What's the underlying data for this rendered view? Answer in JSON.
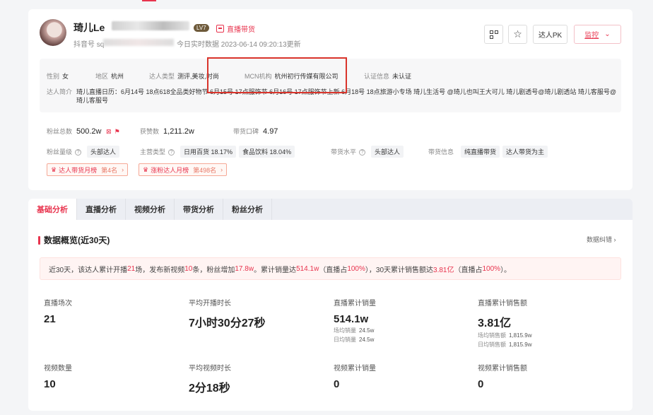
{
  "profile": {
    "name": "琦儿Le",
    "level_badge": "LV7",
    "live_tag": "直播带货",
    "douyin_id": "抖音号 sq",
    "update_text": "今日实时数据   2023-06-14 09:20:13更新",
    "pk_label": "达人PK",
    "monitor_label": "监控",
    "gender_label": "性别",
    "gender": "女",
    "region_label": "地区",
    "region": "杭州",
    "type_label": "达人类型",
    "type": "测评,美妆,时尚",
    "mcn_label": "MCN机构",
    "mcn": "杭州初行传媒有限公司",
    "verify_label": "认证信息",
    "verify": "未认证",
    "intro_label": "达人简介",
    "intro": "琦儿直播日历：6月14号 18点618全品类好物节 6月15号 17点服饰节 6月16号 17点服饰节上新 6月18号 18点旅游小专场 琦儿生活号 @琦儿也叫王大可儿 琦儿剧透号@琦儿剧透站 琦儿客服号@琦儿客服号"
  },
  "stats": {
    "fans_label": "粉丝总数",
    "fans": "500.2w",
    "likes_label": "获赞数",
    "likes": "1,211.2w",
    "reputation_label": "带货口碑",
    "reputation": "4.97",
    "fans_level_label": "粉丝量级",
    "fans_level": "头部达人",
    "category_label": "主营类型",
    "category_1": "日用百货 18.17%",
    "category_2": "食品饮料 18.04%",
    "sales_level_label": "带货水平",
    "sales_level": "头部达人",
    "sales_info_label": "带货信息",
    "sales_info_1": "纯直播带货",
    "sales_info_2": "达人带货为主",
    "rank_1": "达人带货月榜",
    "rank_1_pos": "第4名",
    "rank_2": "涨粉达人月榜",
    "rank_2_pos": "第498名"
  },
  "tabs": [
    "基础分析",
    "直播分析",
    "视频分析",
    "带货分析",
    "粉丝分析"
  ],
  "overview": {
    "title": "数据概览(近30天)",
    "export": "数据纠错",
    "summary": {
      "p1": "近30天，该达人累计开播",
      "live_count": "21",
      "p2": "场，发布新视频",
      "video_count": "10",
      "p3": "条，粉丝增加",
      "fans_growth": "17.8w",
      "p4": "。累计销量达",
      "sales": "514.1w",
      "p5": "（直播占",
      "sales_live_pct": "100%",
      "p6": "），30天累计销售额达",
      "gmv": "3.81亿",
      "p7": "（直播占",
      "gmv_live_pct": "100%",
      "p8": "）。"
    },
    "metrics": {
      "live_sessions_label": "直播场次",
      "live_sessions": "21",
      "avg_live_duration_label": "平均开播时长",
      "avg_live_duration": "7小时30分27秒",
      "live_sales_label": "直播累计销量",
      "live_sales": "514.1w",
      "live_sales_avg_label": "场均销量",
      "live_sales_avg": "24.5w",
      "live_sales_daily_label": "日均销量",
      "live_sales_daily": "24.5w",
      "live_gmv_label": "直播累计销售额",
      "live_gmv": "3.81亿",
      "live_gmv_avg_label": "场均销售额",
      "live_gmv_avg": "1,815.9w",
      "live_gmv_daily_label": "日均销售额",
      "live_gmv_daily": "1,815.9w",
      "video_count_label": "视频数量",
      "video_count": "10",
      "avg_video_duration_label": "平均视频时长",
      "avg_video_duration": "2分18秒",
      "video_sales_label": "视频累计销量",
      "video_sales": "0",
      "video_gmv_label": "视频累计销售额",
      "video_gmv": "0"
    }
  }
}
